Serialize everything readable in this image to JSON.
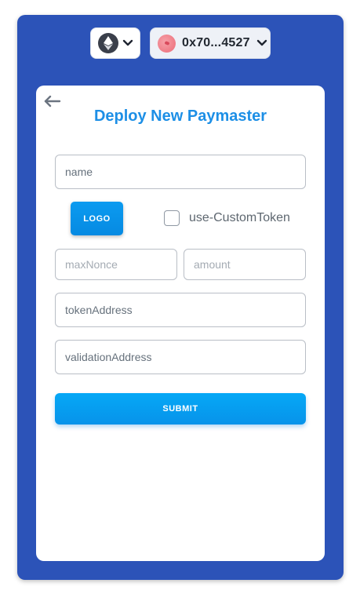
{
  "header": {
    "network_icon": "ethereum-icon",
    "account_label": "0x70...4527",
    "account_icon": "avatar"
  },
  "form": {
    "title": "Deploy New Paymaster",
    "name_placeholder": "name",
    "logo_label": "LOGO",
    "custom_token_label": "use-CustomToken",
    "custom_token_checked": false,
    "maxnonce_placeholder": "maxNonce",
    "amount_placeholder": "amount",
    "token_address_placeholder": "tokenAddress",
    "validation_address_placeholder": "validationAddress",
    "submit_label": "SUBMIT"
  },
  "colors": {
    "frame": "#2c53b8",
    "accent": "#1d8fe6",
    "button": "#0793ea"
  }
}
